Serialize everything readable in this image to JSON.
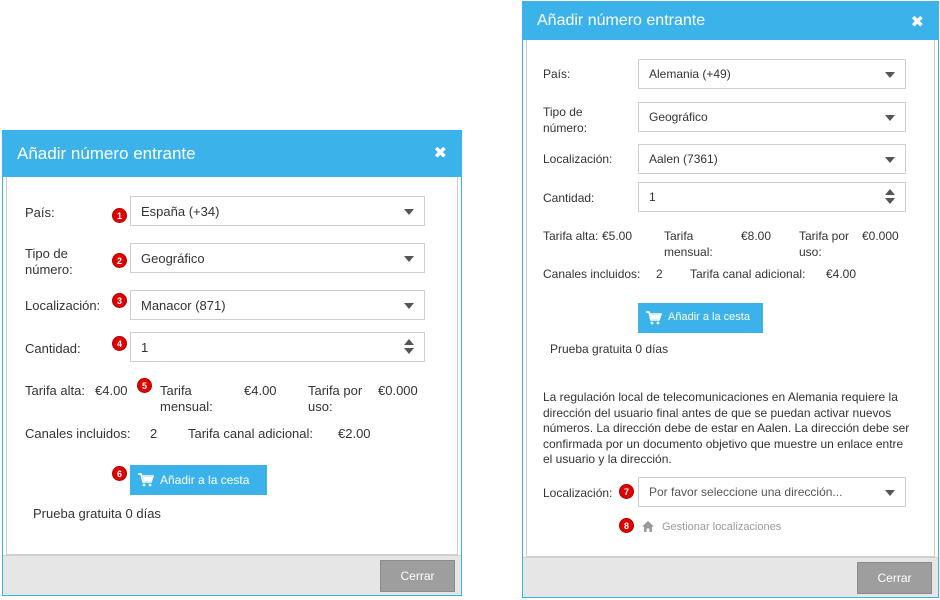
{
  "left_dialog": {
    "title": "Añadir número entrante",
    "fields": {
      "pais_label": "País:",
      "pais_value": "España (+34)",
      "tipo_label": "Tipo de número:",
      "tipo_value": "Geográfico",
      "loc_label": "Localización:",
      "loc_value": "Manacor (871)",
      "cantidad_label": "Cantidad:",
      "cantidad_value": "1"
    },
    "rates": {
      "alta_label": "Tarifa alta:",
      "alta_value": "€4.00",
      "mensual_label": "Tarifa mensual:",
      "mensual_value": "€4.00",
      "uso_label": "Tarifa por uso:",
      "uso_value": "€0.000",
      "canales_label": "Canales incluidos:",
      "canales_value": "2",
      "adicional_label": "Tarifa canal adicional:",
      "adicional_value": "€2.00"
    },
    "add_button": "Añadir a la cesta",
    "trial": "Prueba gratuita 0 días",
    "close_button": "Cerrar",
    "badges": [
      "1",
      "2",
      "3",
      "4",
      "5",
      "6"
    ]
  },
  "right_dialog": {
    "title": "Añadir número entrante",
    "fields": {
      "pais_label": "País:",
      "pais_value": "Alemania (+49)",
      "tipo_label": "Tipo de número:",
      "tipo_value": "Geográfico",
      "loc_label": "Localización:",
      "loc_value": "Aalen (7361)",
      "cantidad_label": "Cantidad:",
      "cantidad_value": "1"
    },
    "rates": {
      "alta_label": "Tarifa alta:",
      "alta_value": "€5.00",
      "mensual_label": "Tarifa mensual:",
      "mensual_value": "€8.00",
      "uso_label": "Tarifa por uso:",
      "uso_value": "€0.000",
      "canales_label": "Canales incluidos:",
      "canales_value": "2",
      "adicional_label": "Tarifa canal adicional:",
      "adicional_value": "€4.00"
    },
    "add_button": "Añadir a la cesta",
    "trial": "Prueba gratuita 0 días",
    "regulation": "La regulación local de telecomunicaciones en Alemania requiere la dirección del usuario final antes de que se puedan activar nuevos números. La dirección debe de estar en Aalen. La dirección debe ser confirmada por un documento objetivo que muestre un enlace entre el usuario y la dirección.",
    "address_label": "Localización:",
    "address_placeholder": "Por favor seleccione  una dirección...",
    "manage_link": "Gestionar localizaciones",
    "close_button": "Cerrar",
    "badges": [
      "7",
      "8"
    ]
  },
  "colors": {
    "accent": "#3bb3ea",
    "badge": "#e00000",
    "footer_bg": "#e6e6e6",
    "close_btn": "#9e9e9e"
  },
  "icons": [
    "close-icon",
    "chevron-down-icon",
    "spinner-up-icon",
    "spinner-down-icon",
    "cart-icon",
    "home-icon"
  ]
}
